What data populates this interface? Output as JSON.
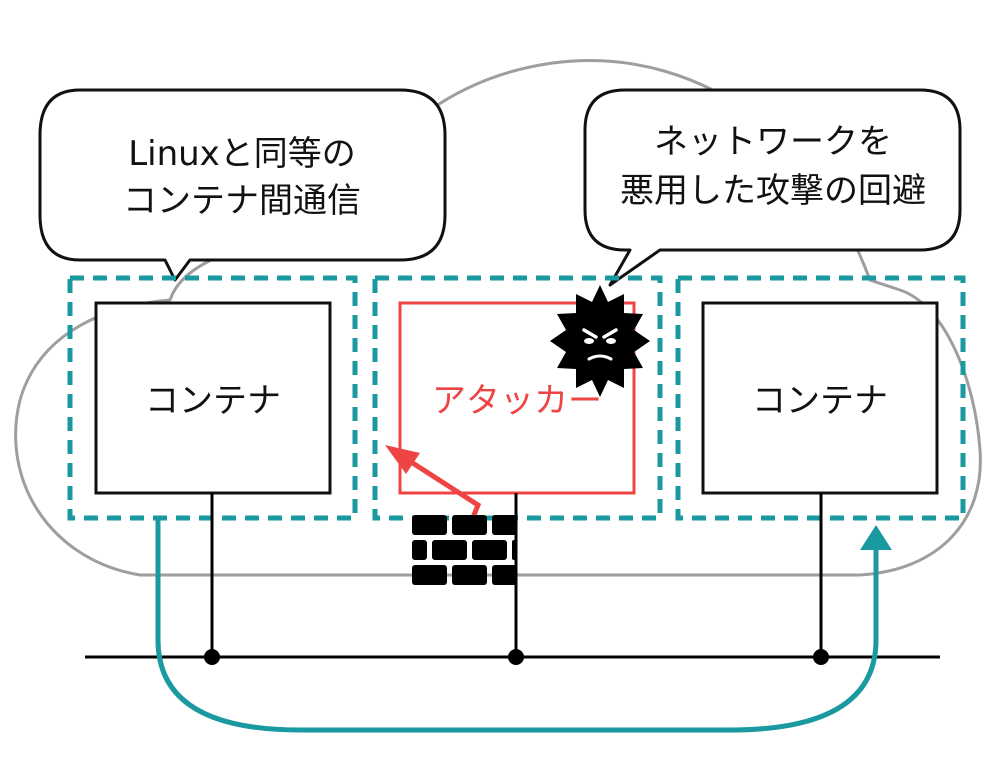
{
  "callouts": {
    "left": {
      "line1": "Linuxと同等の",
      "line2": "コンテナ間通信"
    },
    "right": {
      "line1": "ネットワークを",
      "line2": "悪用した攻撃の回避"
    }
  },
  "nodes": {
    "container_left": "コンテナ",
    "attacker": "アタッカー",
    "container_right": "コンテナ"
  },
  "icons": {
    "attacker_badge": "angry-spiky-face-icon",
    "firewall": "brick-wall-icon"
  },
  "colors": {
    "cloud_outline": "#9e9e9e",
    "isolation_boundary": "#1a9aa0",
    "attacker": "#ef4444",
    "network_line": "#000000",
    "comm_path": "#1a9aa0"
  }
}
